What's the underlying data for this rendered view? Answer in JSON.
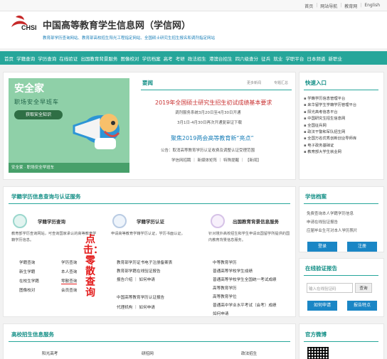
{
  "top_links": [
    "首页",
    "网站导航",
    "教育网",
    "English"
  ],
  "site": {
    "title": "中国高等教育学生信息网（学信网）",
    "subtitle": "教育部学历查询网站、教育部高校招生阳光工程指定网站、全国硕士研究生招生报名和调剂指定网站",
    "logo_text": "CHSI"
  },
  "nav": [
    "首页",
    "学籍查询",
    "学历查询",
    "在线验证",
    "出国教育背景服务",
    "图像校对",
    "学信档案",
    "高考",
    "考研",
    "政法招生",
    "港澳台招生",
    "四六级查分",
    "征兵",
    "就业",
    "学职平台",
    "日本频道",
    "新职业"
  ],
  "banner": {
    "title": "安全家",
    "subtitle": "职场安全早班车",
    "button": "获取安全知识",
    "footer": "安全家 · 职场安全早班车"
  },
  "news": {
    "heading": "要闻",
    "more": "更多新闻",
    "special": "专题汇总",
    "headline1": "2019年全国硕士研究生招生初试成绩基本要求",
    "line1": "调剂服务系统3月20日至4月30日开通",
    "line2": "3月1日-4月30日再次开通复审证下载",
    "headline2": "聚焦2019两会高等教育新“亮点”",
    "line3": "公告：取消高等教育学历认证收费及调整认证受理范围",
    "line4": "学信网招聘 ｜ 新媒体矩阵 ｜ 特殊提醒 ｜ 【新闻】"
  },
  "quick": {
    "heading": "快速入口",
    "items": [
      "学籍学历信息管理平台",
      "来华留学生学籍学历管理平台",
      "阳光高考信息平台",
      "中国研究生招生信息网",
      "全国征兵网",
      "政法干警和军队招生网",
      "全国万名优秀创新创业导师库",
      "电子政务基础证",
      "教育部大学生就业网"
    ]
  },
  "query": {
    "heading": "学籍学历信息查询与认证服务",
    "cards": [
      {
        "title": "学籍学历查询",
        "desc": "教育部学历查询网站，可查询国家承认的高等教育学籍学历信息。",
        "links": [
          "学籍查询",
          "学历查询",
          "新生学籍",
          "本人查询",
          "在校生学籍",
          "零散查询",
          "图像校对",
          "会员查询"
        ]
      },
      {
        "title": "学籍学历认证",
        "desc": "申请高等教育学籍学历认证，学历书面认证。",
        "links": [
          "教育部学历证书电子注册备案表",
          "教育部学籍在线验证报告",
          "报告介绍 ｜ 如何申请",
          "中国高等教育学历认证报告",
          "代理机构 ｜ 如何申请"
        ]
      },
      {
        "title": "出国教育背景信息服务",
        "desc": "针对境外高校招生和学生申请出国留学所提供的国内教育背景信息服务。",
        "links": [
          "中等教育学历",
          "普通高等学校学生成绩",
          "普通高等学校学生全国统一考试成绩",
          "高等教育学历",
          "高等教育学位",
          "普通高中学业水平考试（会考）成绩",
          "如何申请"
        ]
      }
    ]
  },
  "annotation": {
    "text": "点击：零散查询"
  },
  "archive": {
    "heading": "学信档案",
    "lines": [
      "免费查询本人学籍学历信息",
      "申请在线验证报告",
      "应届毕业生可对本人学历照片"
    ],
    "login": "登录",
    "register": "注册"
  },
  "verify": {
    "heading": "在线验证报告",
    "placeholder": "输入在线验证码",
    "query": "查询",
    "apply": "如何申请",
    "features": "报告特点"
  },
  "admission": {
    "heading": "高校招生信息服务",
    "items": [
      "阳光高考",
      "研招网",
      "政法招生"
    ]
  },
  "weibo": {
    "heading": "官方微博"
  },
  "colors": {
    "teal": "#26a69a",
    "blue": "#1a86c5",
    "red": "#c93131",
    "bg": "#f2f2f2"
  }
}
